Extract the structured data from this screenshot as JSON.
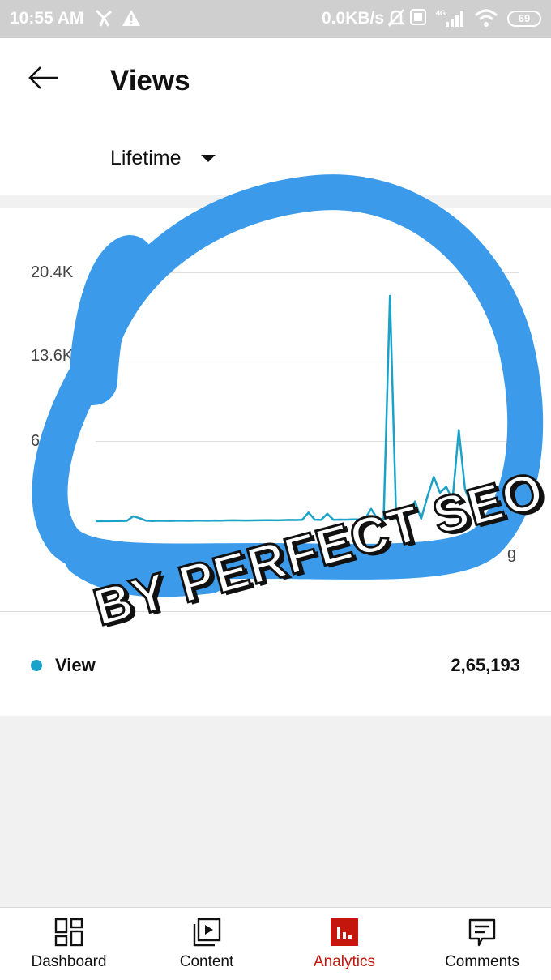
{
  "status_bar": {
    "time": "10:55 AM",
    "net_speed": "0.0KB/s",
    "network_type": "4G",
    "battery": "69",
    "icons": [
      "notification-icon",
      "warning-icon",
      "mute-icon",
      "volte-icon",
      "signal-icon",
      "wifi-icon",
      "battery-icon"
    ]
  },
  "header": {
    "back_icon": "back-arrow-icon",
    "title": "Views",
    "period": "Lifetime"
  },
  "chart": {
    "y_ticks": [
      "20.4K",
      "13.6K",
      "6.8"
    ],
    "x_tick_fragment": "g",
    "legend_label": "View",
    "total": "2,65,193",
    "colors": {
      "line": "#1aa2c8",
      "annotation": "#3b9bea"
    }
  },
  "chart_data": {
    "type": "line",
    "ylim": [
      0,
      20400
    ],
    "series": [
      {
        "name": "View",
        "values": [
          200,
          210,
          205,
          220,
          215,
          230,
          600,
          450,
          250,
          220,
          240,
          230,
          225,
          235,
          240,
          230,
          250,
          245,
          240,
          255,
          250,
          260,
          270,
          260,
          255,
          265,
          270,
          280,
          275,
          270,
          290,
          300,
          295,
          310,
          900,
          320,
          300,
          800,
          310,
          330,
          320,
          350,
          340,
          360,
          1200,
          400,
          380,
          18500,
          420,
          500,
          700,
          1800,
          400,
          2200,
          3800,
          2500,
          3000,
          1900,
          7600,
          2800,
          1500,
          800,
          600,
          500,
          700,
          420,
          1800
        ]
      }
    ]
  },
  "watermark": "BY PERFECT SEO",
  "bottom_nav": [
    {
      "label": "Dashboard",
      "icon": "dashboard-icon",
      "active": false
    },
    {
      "label": "Content",
      "icon": "content-icon",
      "active": false
    },
    {
      "label": "Analytics",
      "icon": "analytics-icon",
      "active": true
    },
    {
      "label": "Comments",
      "icon": "comments-icon",
      "active": false
    }
  ]
}
